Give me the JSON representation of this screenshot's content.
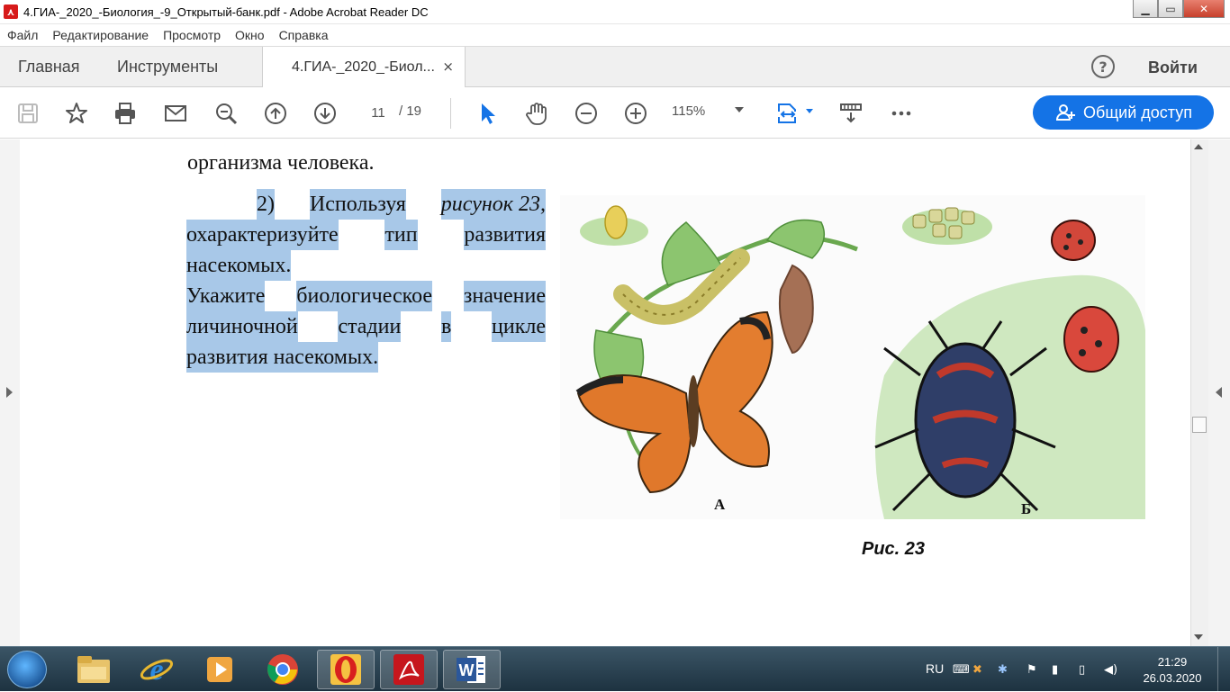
{
  "window": {
    "title": "4.ГИА-_2020_-Биология_-9_Открытый-банк.pdf - Adobe Acrobat Reader DC",
    "minimize": "▁",
    "maximize": "▭",
    "close": "✕"
  },
  "menu": [
    "Файл",
    "Редактирование",
    "Просмотр",
    "Окно",
    "Справка"
  ],
  "tabs": {
    "home": "Главная",
    "tools": "Инструменты",
    "document": "4.ГИА-_2020_-Биол...",
    "close": "×",
    "help": "?",
    "login": "Войти"
  },
  "toolbar": {
    "current_page": "11",
    "page_separator": "/ 19",
    "zoom": "115%",
    "share_label": "Общий доступ"
  },
  "document": {
    "top_line": "организма человека.",
    "para_num": "2)",
    "para_word1": "Используя",
    "para_italic": "рисунок 23,",
    "line2": [
      "охарактеризуйте",
      "тип",
      "развития"
    ],
    "line3": "насекомых.",
    "line4": [
      "Укажите",
      "биологическое",
      "значение"
    ],
    "line5": [
      "личиночной",
      "стадии",
      "в",
      "цикле"
    ],
    "line6": "развития насекомых.",
    "figure_label_a": "А",
    "figure_label_b": "Б",
    "figure_caption": "Рис. 23"
  },
  "taskbar": {
    "apps": [
      "explorer",
      "ie",
      "media",
      "chrome",
      "opera",
      "acrobat",
      "word"
    ],
    "language": "RU",
    "time": "21:29",
    "date": "26.03.2020"
  },
  "colors": {
    "accent": "#1473e6",
    "highlight": "#a8c8e8",
    "selection_arrow": "#1473e6"
  }
}
